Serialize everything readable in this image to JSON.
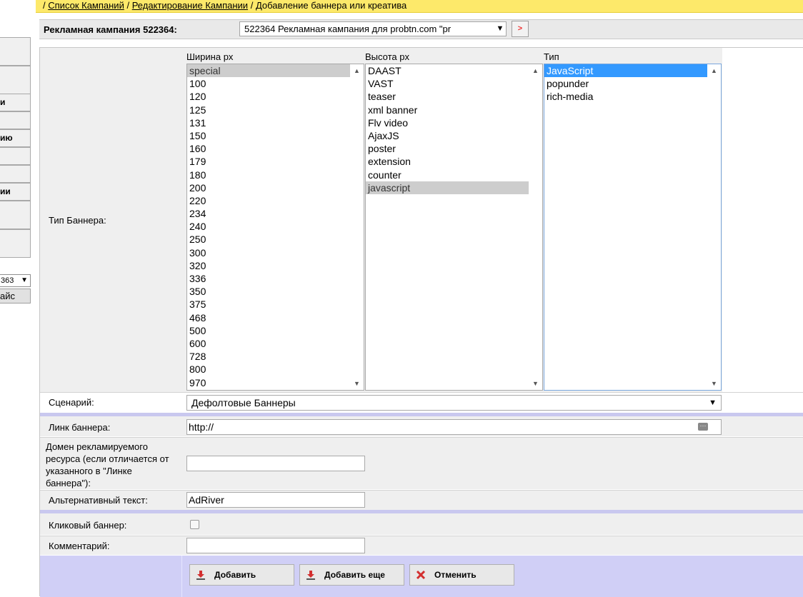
{
  "breadcrumb": {
    "sep": "/",
    "items": [
      {
        "label": "Список Кампаний"
      },
      {
        "label": "Редактирование Кампании"
      }
    ],
    "current": "Добавление баннера или креатива"
  },
  "sidebar": {
    "labels": [
      "и",
      "ию",
      "ии"
    ],
    "select_value": "363",
    "go_label": "айс"
  },
  "campaign": {
    "label": "Рекламная кампания 522364:",
    "selected": "522364 Рекламная кампания для probtn.com \"pr"
  },
  "form": {
    "banner_type_label": "Тип Баннера:",
    "width": {
      "header": "Ширина px",
      "options": [
        "special",
        "100",
        "120",
        "125",
        "131",
        "150",
        "160",
        "179",
        "180",
        "200",
        "220",
        "234",
        "240",
        "250",
        "300",
        "320",
        "336",
        "350",
        "375",
        "468",
        "500",
        "600",
        "728",
        "800",
        "970"
      ],
      "selected": "special"
    },
    "height": {
      "header": "Высота px",
      "options": [
        "DAAST",
        "VAST",
        "teaser",
        "xml banner",
        "Flv video",
        "AjaxJS",
        "poster",
        "extension",
        "counter",
        "javascript"
      ],
      "selected": "javascript"
    },
    "type": {
      "header": "Тип",
      "options": [
        "JavaScript",
        "popunder",
        "rich-media"
      ],
      "selected": "JavaScript"
    },
    "scenario": {
      "label": "Сценарий:",
      "value": "Дефолтовые Баннеры"
    },
    "banner_link": {
      "label": "Линк баннера:",
      "value": "http://"
    },
    "domain": {
      "label": "Домен рекламируемого ресурса (если отличается от указанного в \"Линке баннера\"):",
      "value": ""
    },
    "alt_text": {
      "label": "Альтернативный текст:",
      "value": "AdRiver"
    },
    "click_banner": {
      "label": "Кликовый баннер:",
      "checked": false
    },
    "comment": {
      "label": "Комментарий:",
      "value": ""
    }
  },
  "buttons": {
    "add": "Добавить",
    "add_more": "Добавить еще",
    "cancel": "Отменить"
  },
  "colors": {
    "breadcrumb_bg": "#fde96a",
    "separator": "#c9c8ef",
    "row_bg": "#efefef",
    "selection_blue": "#3399ff",
    "button_bar": "#d0cff6"
  }
}
